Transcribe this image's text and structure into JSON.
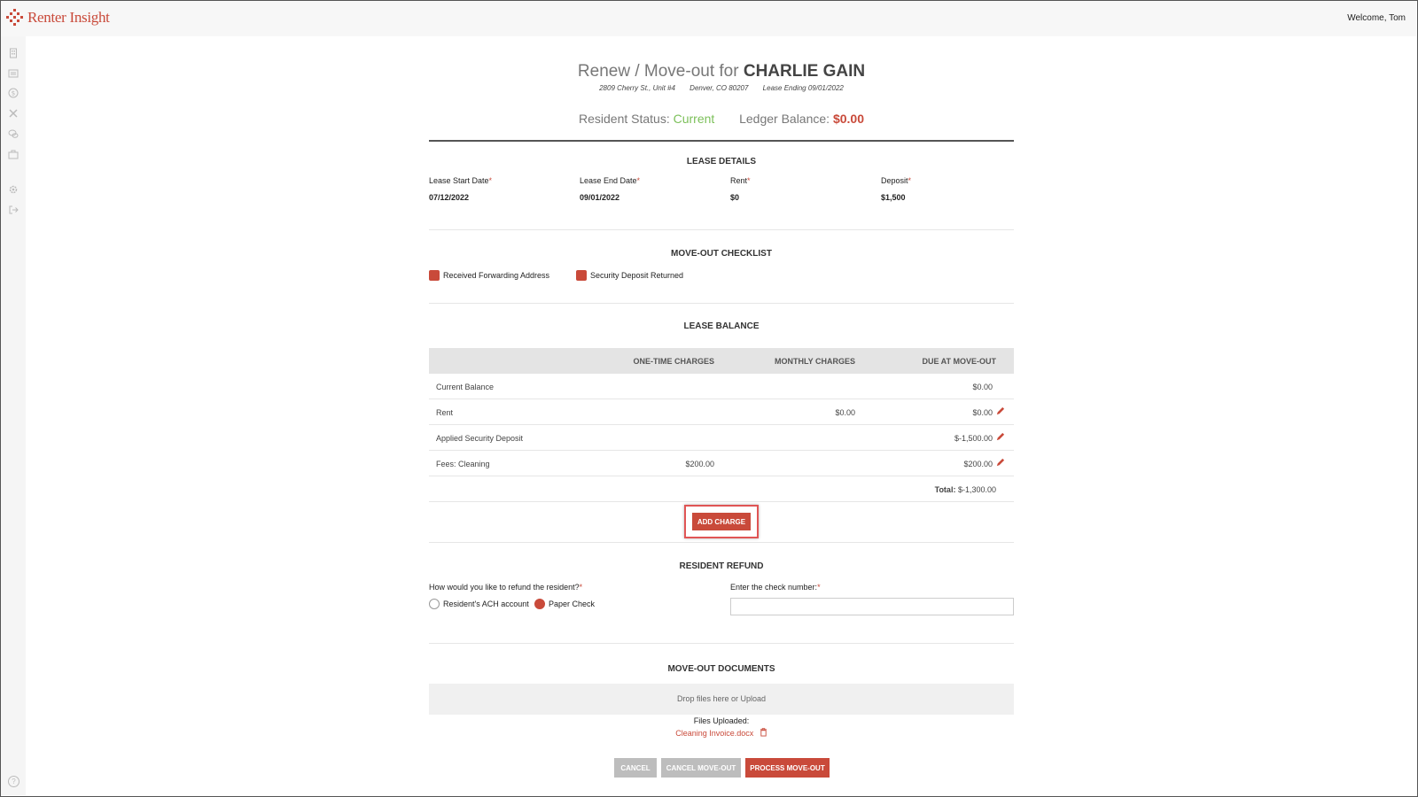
{
  "app": {
    "logo_text": "Renter Insight",
    "welcome": "Welcome, Tom"
  },
  "header": {
    "title_prefix": "Renew / Move-out for",
    "resident_name": "CHARLIE GAIN",
    "address": "2809 Cherry St., Unit #4",
    "city": "Denver, CO 80207",
    "lease_ending": "Lease Ending 09/01/2022",
    "status_label": "Resident Status:",
    "status_value": "Current",
    "balance_label": "Ledger Balance:",
    "balance_value": "$0.00"
  },
  "lease_details": {
    "title": "LEASE DETAILS",
    "fields": [
      {
        "label": "Lease Start Date",
        "value": "07/12/2022"
      },
      {
        "label": "Lease End Date",
        "value": "09/01/2022"
      },
      {
        "label": "Rent",
        "value": "$0"
      },
      {
        "label": "Deposit",
        "value": "$1,500"
      }
    ]
  },
  "checklist": {
    "title": "MOVE-OUT CHECKLIST",
    "items": [
      "Received Forwarding Address",
      "Security Deposit Returned"
    ]
  },
  "lease_balance": {
    "title": "LEASE BALANCE",
    "columns": [
      "ONE-TIME CHARGES",
      "MONTHLY CHARGES",
      "DUE AT MOVE-OUT"
    ],
    "rows": [
      {
        "label": "Current Balance",
        "one_time": "",
        "monthly": "",
        "due": "$0.00"
      },
      {
        "label": "Rent",
        "one_time": "",
        "monthly": "$0.00",
        "due": "$0.00"
      },
      {
        "label": "Applied Security Deposit",
        "one_time": "",
        "monthly": "",
        "due": "$-1,500.00"
      },
      {
        "label": "Fees: Cleaning",
        "one_time": "$200.00",
        "monthly": "",
        "due": "$200.00"
      }
    ],
    "total_label": "Total:",
    "total_value": "$-1,300.00",
    "add_charge": "ADD CHARGE"
  },
  "refund": {
    "title": "RESIDENT REFUND",
    "question": "How would you like to refund the resident?",
    "options": [
      "Resident's ACH account",
      "Paper Check"
    ],
    "check_label": "Enter the check number:",
    "check_value": ""
  },
  "documents": {
    "title": "MOVE-OUT DOCUMENTS",
    "drop_text": "Drop files here or Upload",
    "files_label": "Files Uploaded:",
    "file_name": "Cleaning Invoice.docx"
  },
  "actions": {
    "cancel": "CANCEL",
    "cancel_moveout": "CANCEL MOVE-OUT",
    "process": "PROCESS MOVE-OUT"
  },
  "colors": {
    "accent": "#c94a3a",
    "status_green": "#7cc05a"
  }
}
